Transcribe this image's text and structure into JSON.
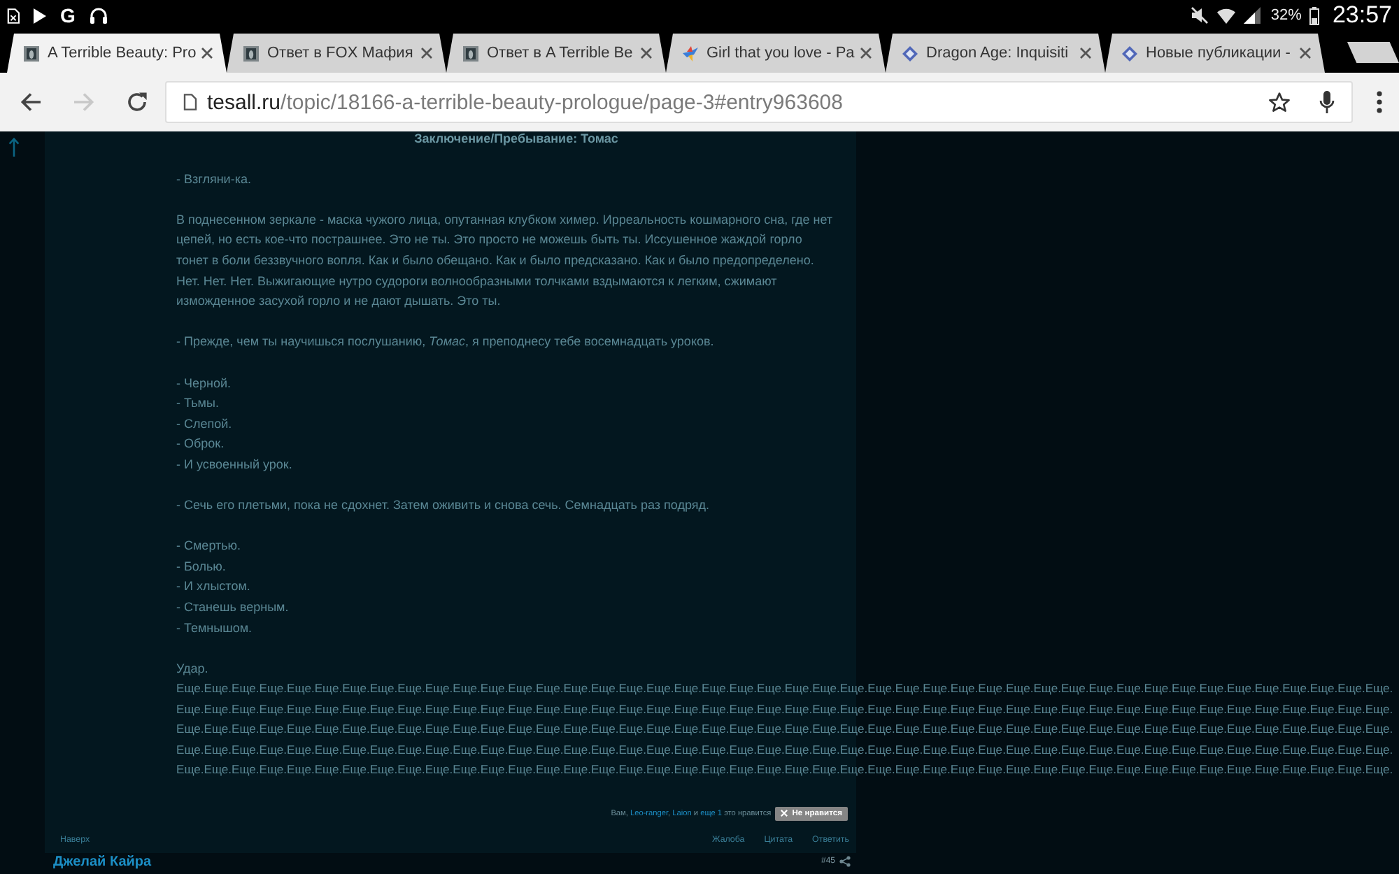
{
  "status_bar": {
    "notification_letter": "G",
    "battery": "32%",
    "time": "23:57"
  },
  "tabs": [
    {
      "title": "A Terrible Beauty: Pro",
      "kind": "portrait",
      "selected": true
    },
    {
      "title": "Ответ в FOX Мафия",
      "kind": "portrait",
      "selected": false
    },
    {
      "title": "Ответ в A Terrible Be",
      "kind": "portrait",
      "selected": false
    },
    {
      "title": "Girl that you love - Pa",
      "kind": "bird",
      "selected": false
    },
    {
      "title": "Dragon Age: Inquisiti",
      "kind": "emblem",
      "selected": false
    },
    {
      "title": "Новые публикации -",
      "kind": "emblem",
      "selected": false
    }
  ],
  "toolbar": {
    "forward_disabled": true,
    "url_host": "tesall.ru",
    "url_path": "/topic/18166-a-terrible-beauty-prologue/page-3#entry963608"
  },
  "post": {
    "heading": "Заключение/Пребывание: Томас",
    "blocks": [
      {
        "lines": [
          "- Взгляни-ка."
        ]
      },
      {
        "text": "В поднесенном зеркале - маска чужого лица, опутанная клубком химер. Ирреальность кошмарного сна, где нет цепей, но есть кое-что пострашнее. Это не ты. Это просто не можешь быть ты. Иссушенное жаждой горло тонет в боли беззвучного вопля. Как и было обещано. Как и было предсказано. Как и было предопределено. Нет. Нет. Нет. Выжигающие нутро судороги волнообразными толчками вздымаются к легким, сжимают изможденное засухой горло и не дают дышать. Это ты."
      },
      {
        "lines": [
          "- Прежде, чем ты научишься послушанию, *Томас*, я преподнесу тебе восемнадцать уроков."
        ]
      },
      {
        "lines": [
          "- Черной.",
          "- Тьмы.",
          "- Слепой.",
          "- Оброк.",
          "- И усвоенный урок."
        ]
      },
      {
        "lines": [
          "- Сечь его плетьми, пока не сдохнет. Затем оживить и снова сечь. Семнадцать раз подряд."
        ]
      },
      {
        "lines": [
          "- Смертью.",
          "- Болью.",
          "- И хлыстом.",
          "- Станешь верным.",
          "- Темнышом."
        ]
      },
      {
        "lines": [
          "Удар."
        ]
      }
    ],
    "repeated_lines": [
      "Еще.Еще.Еще.Еще.Еще.Еще.Еще.Еще.Еще.Еще.Еще.Еще.Еще.Еще.Еще.Еще.Еще.Еще.Еще.Еще.Еще.Еще.Еще.Еще.Еще.Еще.Еще.Еще.Еще.Еще.Еще.Еще.Еще.Еще.Еще.Еще.Еще.Еще.Еще.Еще.Еще.Еще.Еще.Еще.",
      "Еще.Еще.Еще.Еще.Еще.Еще.Еще.Еще.Еще.Еще.Еще.Еще.Еще.Еще.Еще.Еще.Еще.Еще.Еще.Еще.Еще.Еще.Еще.Еще.Еще.Еще.Еще.Еще.Еще.Еще.Еще.Еще.Еще.Еще.Еще.Еще.Еще.Еще.Еще.Еще.Еще.Еще.Еще.Еще.",
      "Еще.Еще.Еще.Еще.Еще.Еще.Еще.Еще.Еще.Еще.Еще.Еще.Еще.Еще.Еще.Еще.Еще.Еще.Еще.Еще.Еще.Еще.Еще.Еще.Еще.Еще.Еще.Еще.Еще.Еще.Еще.Еще.Еще.Еще.Еще.Еще.Еще.Еще.Еще.Еще.Еще.Еще.Еще.Еще.",
      "Еще.Еще.Еще.Еще.Еще.Еще.Еще.Еще.Еще.Еще.Еще.Еще.Еще.Еще.Еще.Еще.Еще.Еще.Еще.Еще.Еще.Еще.Еще.Еще.Еще.Еще.Еще.Еще.Еще.Еще.Еще.Еще.Еще.Еще.Еще.Еще.Еще.Еще.Еще.Еще.Еще.Еще.Еще.Еще.",
      "Еще.Еще.Еще.Еще.Еще.Еще.Еще.Еще.Еще.Еще.Еще.Еще.Еще.Еще.Еще.Еще.Еще.Еще.Еще.Еще.Еще.Еще.Еще.Еще.Еще.Еще.Еще.Еще.Еще.Еще.Еще.Еще.Еще.Еще.Еще.Еще.Еще.Еще.Еще.Еще.Еще.Еще.Еще.Еще."
    ],
    "likes": [
      {
        "kind": "text",
        "text": "Вам, "
      },
      {
        "kind": "link",
        "text": "Leo-ranger"
      },
      {
        "kind": "text",
        "text": ", "
      },
      {
        "kind": "link",
        "text": "Laion"
      },
      {
        "kind": "text",
        "text": " и "
      },
      {
        "kind": "link",
        "text": "еще 1"
      },
      {
        "kind": "text",
        "text": " это нравится"
      }
    ],
    "unlike_button": "Не нравится",
    "top_link": "Наверх",
    "actions": [
      "Жалоба",
      "Цитата",
      "Ответить"
    ]
  },
  "next_post": {
    "author": "Джелай Кайра",
    "number": "#45"
  }
}
